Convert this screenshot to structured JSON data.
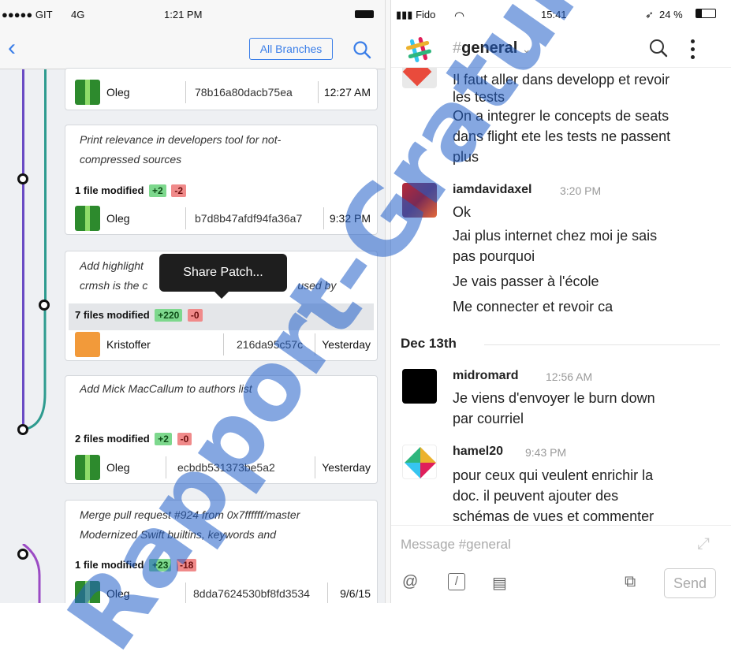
{
  "left": {
    "status": {
      "carrier": "●●●●● GIT",
      "network": "4G",
      "time": "1:21 PM"
    },
    "nav": {
      "back_icon": "chevron-left-icon",
      "branches_label": "All Branches",
      "search_icon": "search-icon"
    },
    "commits": [
      {
        "author": "Oleg",
        "sha": "78b16a80dacb75ea",
        "time": "12:27 AM"
      },
      {
        "message_lines": [
          "Print relevance in developers tool for not-",
          "compressed sources"
        ],
        "files": "1 file modified",
        "added": "+2",
        "removed": "-2",
        "author": "Oleg",
        "sha": "b7d8b47afdf94fa36a7",
        "time": "9:32 PM"
      },
      {
        "message_lines": [
          "Add highlight",
          "crmsh is the c",
          "used by"
        ],
        "files": "7 files modified",
        "added": "+220",
        "removed": "-0",
        "author": "Kristoffer",
        "sha": "216da95c57c",
        "time": "Yesterday"
      },
      {
        "message_lines": [
          "Add Mick MacCallum to authors list"
        ],
        "files": "2 files modified",
        "added": "+2",
        "removed": "-0",
        "author": "Oleg",
        "sha": "ecbdb531373be5a2",
        "time": "Yesterday"
      },
      {
        "message_lines": [
          "Merge pull request #924 from 0x7ffffff/master",
          "Modernized Swift builtins, keywords and"
        ],
        "files": "1 file modified",
        "added": "+23",
        "removed": "-18",
        "author": "Oleg",
        "sha": "8dda7624530bf8fd3534",
        "time": "9/6/15"
      }
    ],
    "tooltip": "Share Patch..."
  },
  "right": {
    "status": {
      "carrier": "▮▮▮ Fido",
      "time": "15:41",
      "battery": "24 %"
    },
    "header": {
      "channel": "general",
      "hash": "#"
    },
    "messages": {
      "cont_lines": [
        "Il faut aller dans developp et revoir",
        "les tests",
        "On a integrer le concepts de seats",
        "dans flight ete les tests ne passent",
        "plus"
      ],
      "m1": {
        "user": "iamdavidaxel",
        "time": "3:20 PM",
        "lines": [
          "Ok",
          "Jai plus internet chez moi je sais",
          "pas pourquoi",
          "Je vais passer à l'école",
          "Me connecter et revoir ca"
        ]
      },
      "day": "Dec 13th",
      "m2": {
        "user": "midromard",
        "time": "12:56 AM",
        "lines": [
          "Je viens d'envoyer le burn down",
          "par courriel"
        ]
      },
      "m3": {
        "user": "hamel20",
        "time": "9:43 PM",
        "lines": [
          "pour ceux qui veulent enrichir la",
          "doc. il  peuvent ajouter des",
          "schémas de vues et commenter"
        ]
      }
    },
    "composer": {
      "placeholder": "Message #general",
      "send": "Send"
    }
  },
  "watermark": "Rapport-Gratuit"
}
